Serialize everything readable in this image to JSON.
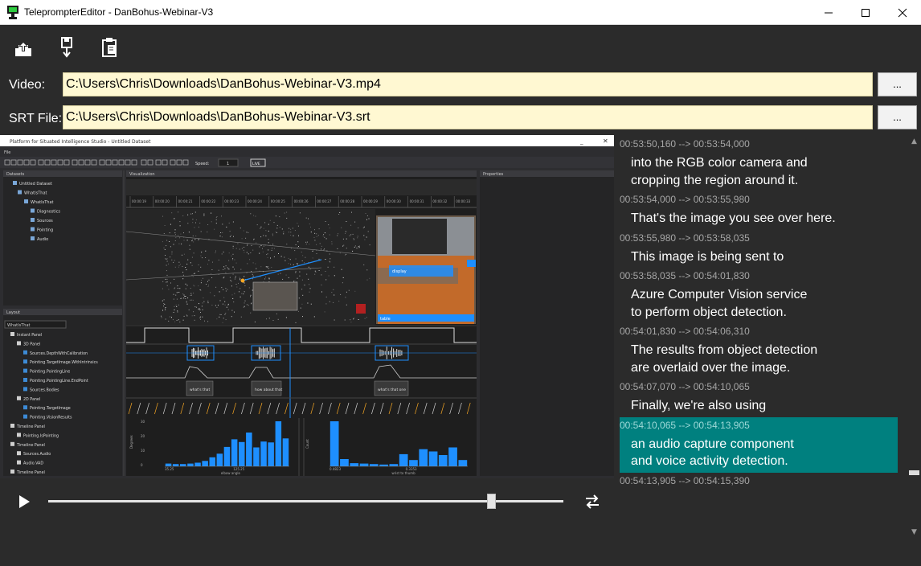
{
  "window": {
    "title": "TeleprompterEditor - DanBohus-Webinar-V3",
    "minimize": "—",
    "maximize": "☐",
    "close": "✕"
  },
  "toolbar": {
    "icons": [
      "open-upload-icon",
      "save-download-icon",
      "paste-clipboard-icon"
    ]
  },
  "fields": {
    "video_label": "Video:",
    "video_path": "C:\\Users\\Chris\\Downloads\\DanBohus-Webinar-V3.mp4",
    "srt_label": "SRT File:",
    "srt_path": "C:\\Users\\Chris\\Downloads\\DanBohus-Webinar-V3.srt",
    "browse_label": "..."
  },
  "embedded": {
    "window_title": "Platform for Situated Intelligence Studio - Untitled Dataset",
    "menu": "File",
    "speed_label": "Speed:",
    "speed_value": "1",
    "live": "LIVE",
    "datasets_tab": "Datasets",
    "visualization_tab": "Visualization",
    "properties_tab": "Properties",
    "layout_tab": "Layout",
    "tree": [
      "Untitled Dataset",
      "WhatIsThat",
      "WhatIsThat",
      "Diagnostics",
      "Sources",
      "Pointing",
      "Audio"
    ],
    "layout_value": "WhatIsThat",
    "layout_tree": [
      "Instant Panel",
      "3D Panel",
      "Sources.DepthWithCalibration",
      "Pointing.TargetImage.WithIntrinsics",
      "Pointing.PointingLine",
      "Pointing.PointingLine.EndPoint",
      "Sources.Bodies",
      "2D Panel",
      "Pointing.TargetImage",
      "Pointing.VisionResults",
      "Timeline Panel",
      "Pointing.IsPointing",
      "Timeline Panel",
      "Sources.Audio",
      "Audio.VAD",
      "Timeline Panel"
    ],
    "ann": [
      "what's that",
      "how about that",
      "what's that one"
    ],
    "display_label": "display",
    "table_label": "table",
    "hist_left_xlabel": "elbow angle",
    "hist_right_xlabel": "wrist to thumb",
    "hist_left_ylabel": "Degrees",
    "hist_right_ylabel": "Count",
    "hist_left_ticks": [
      "30",
      "20",
      "10",
      "0"
    ],
    "hist_left_x": [
      "35.25",
      "125.25"
    ],
    "hist_right_x": [
      "0.4823",
      "0.3353"
    ],
    "hist_left_values": [
      0.06,
      0.05,
      0.05,
      0.06,
      0.08,
      0.12,
      0.2,
      0.28,
      0.43,
      0.6,
      0.54,
      0.75,
      0.42,
      0.55,
      0.53,
      1.0,
      0.62
    ],
    "hist_right_values": [
      1.0,
      0.16,
      0.07,
      0.06,
      0.05,
      0.04,
      0.05,
      0.27,
      0.14,
      0.38,
      0.33,
      0.25,
      0.42,
      0.14
    ],
    "timeline_ticks": [
      "00:00:19",
      "00:00:20",
      "00:00:21",
      "00:00:22",
      "00:00:23",
      "00:00:24",
      "00:00:25",
      "00:00:26",
      "00:00:27",
      "00:00:28",
      "00:00:29",
      "00:00:30",
      "00:00:31",
      "00:00:32",
      "00:00:33"
    ]
  },
  "subtitles": [
    {
      "time": "00:53:50,160 --> 00:53:54,000",
      "text": "into the RGB color camera and\ncropping the region around it."
    },
    {
      "time": "00:53:54,000 --> 00:53:55,980",
      "text": "That's the image you see over here."
    },
    {
      "time": "00:53:55,980 --> 00:53:58,035",
      "text": "This image is being sent to"
    },
    {
      "time": "00:53:58,035 --> 00:54:01,830",
      "text": "Azure Computer Vision service\nto perform object detection."
    },
    {
      "time": "00:54:01,830 --> 00:54:06,310",
      "text": "The results from object detection\nare overlaid over the image."
    },
    {
      "time": "00:54:07,070 --> 00:54:10,065",
      "text": "Finally, we're also using"
    },
    {
      "time": "00:54:10,065 --> 00:54:13,905",
      "text": "an audio capture component\nand voice activity detection.",
      "selected": true
    },
    {
      "time": "00:54:13,905 --> 00:54:15,390",
      "text": ""
    }
  ],
  "player": {
    "play_icon": "play-icon",
    "swap_icon": "swap-arrows-icon",
    "position": 0.86
  },
  "colors": {
    "field_bg": "#fff8d2",
    "selected_bg": "#00807f",
    "app_bg": "#2b2b2b",
    "accent_blue": "#1e8fff"
  }
}
